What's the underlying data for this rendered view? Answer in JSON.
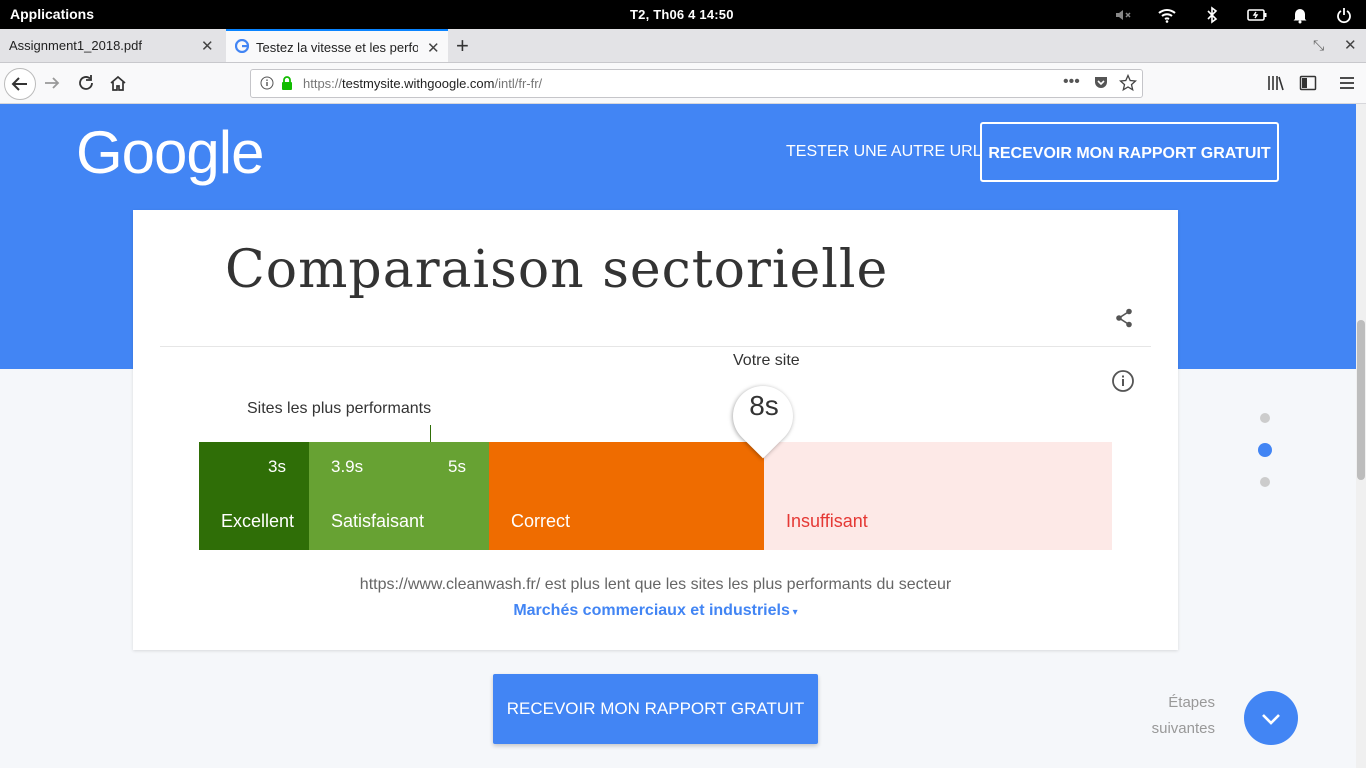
{
  "system_bar": {
    "apps_label": "Applications",
    "datetime": "T2, Th06  4    14:50"
  },
  "tabs": [
    {
      "label": "Assignment1_2018.pdf"
    },
    {
      "label": "Testez la vitesse et les perfor"
    }
  ],
  "address_bar": {
    "url_prefix": "https://",
    "url_domain": "testmysite.withgoogle.com",
    "url_path": "/intl/fr-fr/"
  },
  "header": {
    "logo": "Google",
    "tester_label": "TESTER UNE AUTRE URL",
    "rapport_label": "RECEVOIR MON RAPPORT GRATUIT"
  },
  "card": {
    "title": "Comparaison sectorielle",
    "top_performers_label": "Sites les plus performants",
    "your_site_label": "Votre site",
    "your_site_value": "8s",
    "segments": [
      {
        "name": "Excellent",
        "tick": "3s"
      },
      {
        "name": "Satisfaisant",
        "tick_left": "3.9s",
        "tick_right": "5s"
      },
      {
        "name": "Correct"
      },
      {
        "name": "Insuffisant"
      }
    ],
    "message": "https://www.cleanwash.fr/  est plus lent que les sites les plus performants du secteur",
    "sector": "Marchés commerciaux et industriels"
  },
  "cta_bottom": "RECEVOIR MON RAPPORT GRATUIT",
  "next_steps": {
    "line1": "Étapes",
    "line2": "suivantes"
  },
  "colors": {
    "brand_blue": "#4285f4",
    "excellent": "#2f6e07",
    "satisfaisant": "#67a233",
    "correct": "#ef6c00",
    "insuffisant": "#fde9e7",
    "insuffisant_text": "#e53935"
  }
}
